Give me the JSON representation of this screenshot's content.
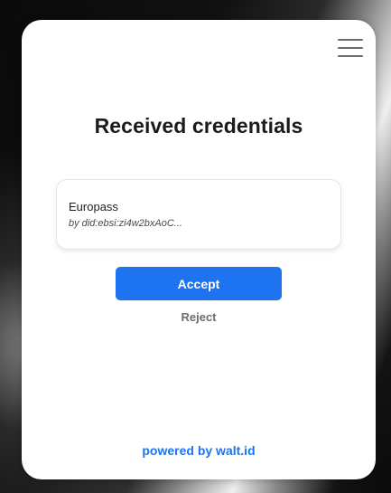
{
  "page": {
    "title": "Received credentials",
    "menu_icon": "hamburger-menu-icon"
  },
  "credential": {
    "title": "Europass",
    "issuer": "by did:ebsi:zi4w2bxAoC..."
  },
  "actions": {
    "accept_label": "Accept",
    "reject_label": "Reject"
  },
  "footer": {
    "powered_by": "powered by walt.id"
  },
  "colors": {
    "accent": "#1e74f0",
    "card_background": "#ffffff",
    "page_background": "#0c0c0c"
  }
}
